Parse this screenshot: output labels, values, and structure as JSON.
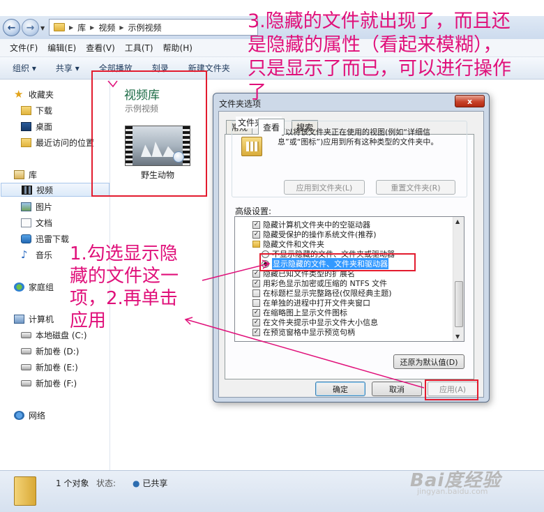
{
  "explorer": {
    "breadcrumb": [
      "库",
      "视频",
      "示例视频"
    ],
    "menu": [
      "文件(F)",
      "编辑(E)",
      "查看(V)",
      "工具(T)",
      "帮助(H)"
    ],
    "commands": [
      "组织",
      "共享",
      "全部播放",
      "刻录",
      "新建文件夹"
    ],
    "nav": {
      "favorites": "收藏夹",
      "fav_items": [
        "下载",
        "桌面",
        "最近访问的位置"
      ],
      "libraries": "库",
      "lib_items": [
        "视频",
        "图片",
        "文档",
        "迅雷下载",
        "音乐"
      ],
      "homegroup": "家庭组",
      "computer": "计算机",
      "drives": [
        "本地磁盘 (C:)",
        "新加卷 (D:)",
        "新加卷 (E:)",
        "新加卷 (F:)"
      ],
      "network": "网络"
    },
    "library_title": "视频库",
    "library_subtitle": "示例视频",
    "video_name": "野生动物",
    "status": {
      "count": "1 个对象",
      "state_label": "状态:",
      "share": "已共享"
    }
  },
  "dialog": {
    "title": "文件夹选项",
    "close": "x",
    "tabs": [
      "常规",
      "查看",
      "搜索"
    ],
    "folder_view_label": "文件夹视图",
    "folder_view_desc": "可以将该文件夹正在使用的视图(例如“详细信息”或“图标”)应用到所有这种类型的文件夹中。",
    "apply_to_folders": "应用到文件夹(L)",
    "reset_folders": "重置文件夹(R)",
    "advanced_label": "高级设置:",
    "advanced": [
      {
        "type": "checkbox",
        "checked": true,
        "label": "隐藏计算机文件夹中的空驱动器"
      },
      {
        "type": "checkbox",
        "checked": true,
        "label": "隐藏受保护的操作系统文件(推荐)"
      },
      {
        "type": "folder",
        "label": "隐藏文件和文件夹"
      },
      {
        "type": "radio",
        "checked": false,
        "label": "不显示隐藏的文件、文件夹或驱动器"
      },
      {
        "type": "radio",
        "checked": true,
        "label": "显示隐藏的文件、文件夹和驱动器"
      },
      {
        "type": "checkbox",
        "checked": true,
        "label": "隐藏已知文件类型的扩展名"
      },
      {
        "type": "checkbox",
        "checked": true,
        "label": "用彩色显示加密或压缩的 NTFS 文件"
      },
      {
        "type": "checkbox",
        "checked": false,
        "label": "在标题栏显示完整路径(仅限经典主题)"
      },
      {
        "type": "checkbox",
        "checked": false,
        "label": "在单独的进程中打开文件夹窗口"
      },
      {
        "type": "checkbox",
        "checked": true,
        "label": "在缩略图上显示文件图标"
      },
      {
        "type": "checkbox",
        "checked": true,
        "label": "在文件夹提示中显示文件大小信息"
      },
      {
        "type": "checkbox",
        "checked": true,
        "label": "在预览窗格中显示预览句柄"
      }
    ],
    "restore_defaults": "还原为默认值(D)",
    "ok": "确定",
    "cancel": "取消",
    "apply": "应用(A)"
  },
  "annotations": {
    "note3": "3.隐藏的文件就出现了，而且还是隐藏的属性（看起来模糊），只是显示了而已，可以进行操作了",
    "note1": "1.勾选显示隐藏的文件这一项，2.再单击应用",
    "watermark": "Bai度经验",
    "watermark_url": "jingyan.baidu.com",
    "accent": "#e0107a",
    "box_color": "#e31b2e"
  }
}
